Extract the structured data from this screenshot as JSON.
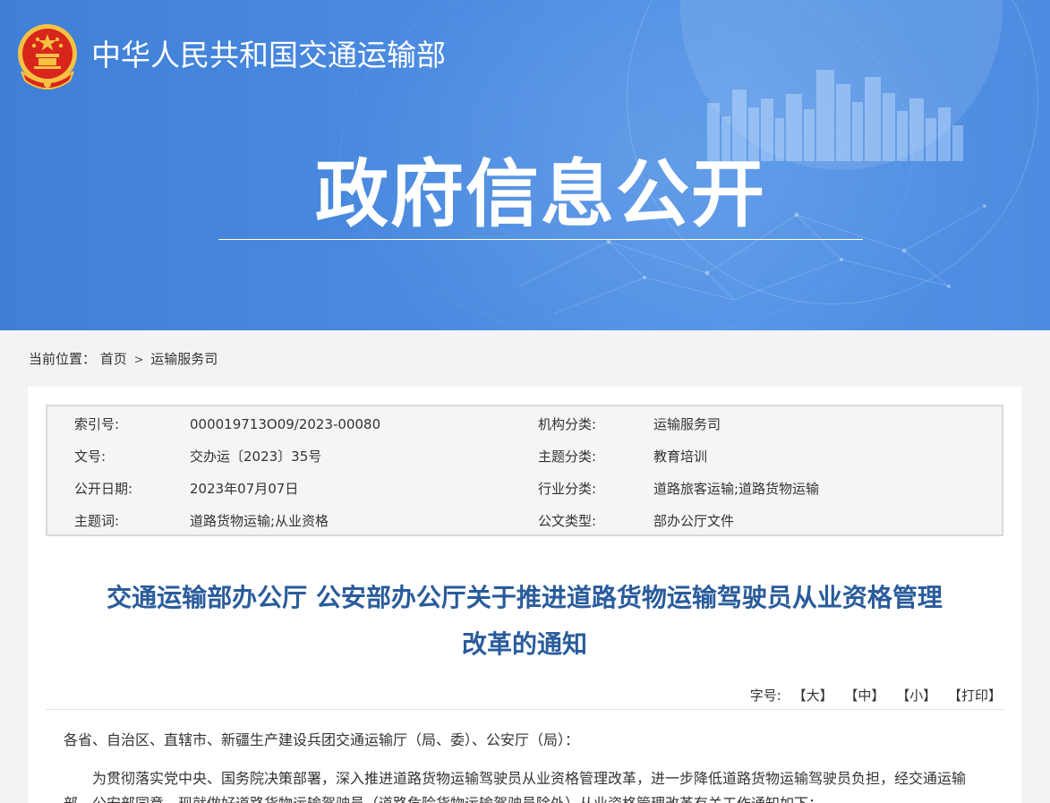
{
  "header": {
    "ministry_name": "中华人民共和国交通运输部",
    "banner_title": "政府信息公开"
  },
  "breadcrumb": {
    "label": "当前位置：",
    "home": "首页",
    "separator": ">",
    "current": "运输服务司"
  },
  "meta": {
    "rows": [
      {
        "k1": "索引号:",
        "v1": "000019713O09/2023-00080",
        "k2": "机构分类:",
        "v2": "运输服务司"
      },
      {
        "k1": "文号:",
        "v1": "交办运〔2023〕35号",
        "k2": "主题分类:",
        "v2": "教育培训"
      },
      {
        "k1": "公开日期:",
        "v1": "2023年07月07日",
        "k2": "行业分类:",
        "v2": "道路旅客运输;道路货物运输"
      },
      {
        "k1": "主题词:",
        "v1": "道路货物运输;从业资格",
        "k2": "公文类型:",
        "v2": "部办公厅文件"
      }
    ]
  },
  "document": {
    "title_line1": "交通运输部办公厅 公安部办公厅关于推进道路货物运输驾驶员从业资格管理",
    "title_line2": "改革的通知",
    "salutation": "各省、自治区、直辖市、新疆生产建设兵团交通运输厅（局、委）、公安厅（局）：",
    "paragraph1": "为贯彻落实党中央、国务院决策部署，深入推进道路货物运输驾驶员从业资格管理改革，进一步降低道路货物运输驾驶员负担，经交通运输部、公安部同意，现就做好道路货物运输驾驶员（道路危险货物运输驾驶员除外）从业资格管理改革有关工作通知如下："
  },
  "font_tools": {
    "label": "字号:",
    "large": "【大】",
    "medium": "【中】",
    "small": "【小】",
    "print": "【打印】"
  },
  "colors": {
    "banner_blue": "#4a8ae0",
    "title_blue": "#2a5c9b",
    "emblem_red": "#d8261c",
    "emblem_gold": "#f5c242"
  }
}
